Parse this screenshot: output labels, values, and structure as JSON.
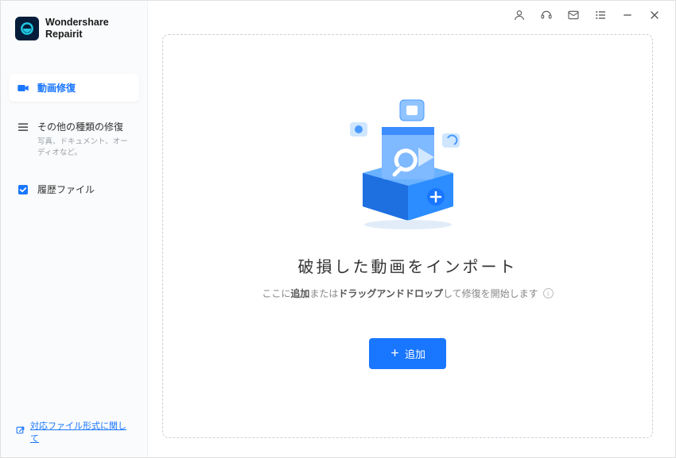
{
  "brand": {
    "line1": "Wondershare",
    "line2": "Repairit"
  },
  "nav": {
    "video": {
      "label": "動画修復"
    },
    "other": {
      "label": "その他の種類の修復",
      "sub": "写真、ドキュメント、オーディオなど。"
    },
    "history": {
      "label": "履歴ファイル"
    }
  },
  "footer_link": "対応ファイル形式に関して",
  "main": {
    "heading": "破損した動画をインポート",
    "sub_pre": "ここに",
    "sub_bold": "追加",
    "sub_mid": "または",
    "sub_bold2": "ドラッグアンドドロップ",
    "sub_post": "して修復を開始します",
    "add_button": "追加"
  }
}
